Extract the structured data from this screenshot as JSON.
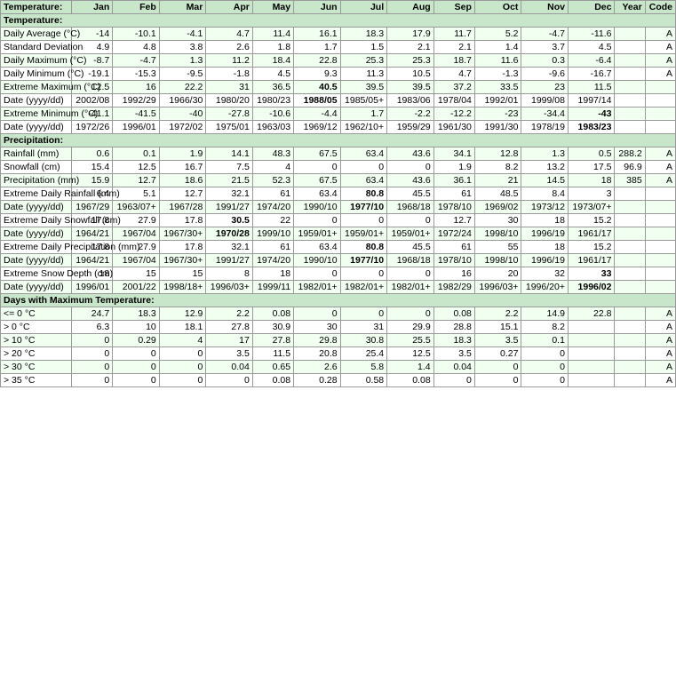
{
  "headers": {
    "row_header": "Temperature:",
    "months": [
      "Jan",
      "Feb",
      "Mar",
      "Apr",
      "May",
      "Jun",
      "Jul",
      "Aug",
      "Sep",
      "Oct",
      "Nov",
      "Dec",
      "Year",
      "Code"
    ]
  },
  "sections": [
    {
      "name": "Temperature:",
      "is_section": true
    },
    {
      "name": "Daily Average (°C)",
      "values": [
        "-14",
        "-10.1",
        "-4.1",
        "4.7",
        "11.4",
        "16.1",
        "18.3",
        "17.9",
        "11.7",
        "5.2",
        "-4.7",
        "-11.6",
        "",
        "A"
      ],
      "bg": "light"
    },
    {
      "name": "Standard Deviation",
      "values": [
        "4.9",
        "4.8",
        "3.8",
        "2.6",
        "1.8",
        "1.7",
        "1.5",
        "2.1",
        "2.1",
        "1.4",
        "3.7",
        "4.5",
        "",
        "A"
      ],
      "bg": "white"
    },
    {
      "name": "Daily Maximum (°C)",
      "values": [
        "-8.7",
        "-4.7",
        "1.3",
        "11.2",
        "18.4",
        "22.8",
        "25.3",
        "25.3",
        "18.7",
        "11.6",
        "0.3",
        "-6.4",
        "",
        "A"
      ],
      "bg": "light"
    },
    {
      "name": "Daily Minimum (°C)",
      "values": [
        "-19.1",
        "-15.3",
        "-9.5",
        "-1.8",
        "4.5",
        "9.3",
        "11.3",
        "10.5",
        "4.7",
        "-1.3",
        "-9.6",
        "-16.7",
        "",
        "A"
      ],
      "bg": "white"
    },
    {
      "name": "Extreme Maximum (°C)",
      "values": [
        "12.5",
        "16",
        "22.2",
        "31",
        "36.5",
        "40.5",
        "39.5",
        "39.5",
        "37.2",
        "33.5",
        "23",
        "11.5",
        "",
        ""
      ],
      "bold_cols": [
        5
      ],
      "bg": "light"
    },
    {
      "name": "Date (yyyy/dd)",
      "values": [
        "2002/08",
        "1992/29",
        "1966/30",
        "1980/20",
        "1980/23",
        "1988/05",
        "1985/05+",
        "1983/06",
        "1978/04",
        "1992/01",
        "1999/08",
        "1997/14",
        "",
        ""
      ],
      "bold_cols": [
        5
      ],
      "bg": "white"
    },
    {
      "name": "Extreme Minimum (°C)",
      "values": [
        "-41.1",
        "-41.5",
        "-40",
        "-27.8",
        "-10.6",
        "-4.4",
        "1.7",
        "-2.2",
        "-12.2",
        "-23",
        "-34.4",
        "-43",
        "",
        ""
      ],
      "bold_cols": [
        11
      ],
      "bg": "light"
    },
    {
      "name": "Date (yyyy/dd)",
      "values": [
        "1972/26",
        "1996/01",
        "1972/02",
        "1975/01",
        "1963/03",
        "1969/12",
        "1962/10+",
        "1959/29",
        "1961/30",
        "1991/30",
        "1978/19",
        "1983/23",
        "",
        ""
      ],
      "bold_cols": [
        11
      ],
      "bg": "white"
    },
    {
      "name": "Precipitation:",
      "is_section": true
    },
    {
      "name": "Rainfall (mm)",
      "values": [
        "0.6",
        "0.1",
        "1.9",
        "14.1",
        "48.3",
        "67.5",
        "63.4",
        "43.6",
        "34.1",
        "12.8",
        "1.3",
        "0.5",
        "288.2",
        "A"
      ],
      "bg": "light"
    },
    {
      "name": "Snowfall (cm)",
      "values": [
        "15.4",
        "12.5",
        "16.7",
        "7.5",
        "4",
        "0",
        "0",
        "0",
        "1.9",
        "8.2",
        "13.2",
        "17.5",
        "96.9",
        "A"
      ],
      "bg": "white"
    },
    {
      "name": "Precipitation (mm)",
      "values": [
        "15.9",
        "12.7",
        "18.6",
        "21.5",
        "52.3",
        "67.5",
        "63.4",
        "43.6",
        "36.1",
        "21",
        "14.5",
        "18",
        "385",
        "A"
      ],
      "bg": "light"
    },
    {
      "name": "Extreme Daily Rainfall (mm)",
      "values": [
        "6.4",
        "5.1",
        "12.7",
        "32.1",
        "61",
        "63.4",
        "80.8",
        "45.5",
        "61",
        "48.5",
        "8.4",
        "3",
        "",
        ""
      ],
      "bold_cols": [
        6
      ],
      "bg": "white"
    },
    {
      "name": "Date (yyyy/dd)",
      "values": [
        "1967/29",
        "1963/07+",
        "1967/28",
        "1991/27",
        "1974/20",
        "1990/10",
        "1977/10",
        "1968/18",
        "1978/10",
        "1969/02",
        "1973/12",
        "1973/07+",
        "",
        ""
      ],
      "bold_cols": [
        6
      ],
      "bg": "light"
    },
    {
      "name": "Extreme Daily Snowfall (cm)",
      "values": [
        "17.8",
        "27.9",
        "17.8",
        "30.5",
        "22",
        "0",
        "0",
        "0",
        "12.7",
        "30",
        "18",
        "15.2",
        "",
        ""
      ],
      "bold_cols": [
        3
      ],
      "bg": "white"
    },
    {
      "name": "Date (yyyy/dd)",
      "values": [
        "1964/21",
        "1967/04",
        "1967/30+",
        "1970/28",
        "1999/10",
        "1959/01+",
        "1959/01+",
        "1959/01+",
        "1972/24",
        "1998/10",
        "1996/19",
        "1961/17",
        "",
        ""
      ],
      "bold_cols": [
        3
      ],
      "bg": "light"
    },
    {
      "name": "Extreme Daily Precipitation (mm)",
      "values": [
        "17.8",
        "27.9",
        "17.8",
        "32.1",
        "61",
        "63.4",
        "80.8",
        "45.5",
        "61",
        "55",
        "18",
        "15.2",
        "",
        ""
      ],
      "bold_cols": [
        6
      ],
      "bg": "white"
    },
    {
      "name": "Date (yyyy/dd)",
      "values": [
        "1964/21",
        "1967/04",
        "1967/30+",
        "1991/27",
        "1974/20",
        "1990/10",
        "1977/10",
        "1968/18",
        "1978/10",
        "1998/10",
        "1996/19",
        "1961/17",
        "",
        ""
      ],
      "bold_cols": [
        6
      ],
      "bg": "light"
    },
    {
      "name": "Extreme Snow Depth (cm)",
      "values": [
        "18",
        "15",
        "15",
        "8",
        "18",
        "0",
        "0",
        "0",
        "16",
        "20",
        "32",
        "33",
        "",
        ""
      ],
      "bold_cols": [
        11
      ],
      "bg": "white"
    },
    {
      "name": "Date (yyyy/dd)",
      "values": [
        "1996/01",
        "2001/22",
        "1998/18+",
        "1996/03+",
        "1999/11",
        "1982/01+",
        "1982/01+",
        "1982/01+",
        "1982/29",
        "1996/03+",
        "1996/20+",
        "1996/02",
        "",
        ""
      ],
      "bold_cols": [
        11
      ],
      "bg": "light"
    },
    {
      "name": "Days with Maximum Temperature:",
      "is_section": true
    },
    {
      "name": "<= 0 °C",
      "values": [
        "24.7",
        "18.3",
        "12.9",
        "2.2",
        "0.08",
        "0",
        "0",
        "0",
        "0.08",
        "2.2",
        "14.9",
        "22.8",
        "",
        "A"
      ],
      "bg": "light"
    },
    {
      "name": "> 0 °C",
      "values": [
        "6.3",
        "10",
        "18.1",
        "27.8",
        "30.9",
        "30",
        "31",
        "29.9",
        "28.8",
        "15.1",
        "8.2",
        "",
        "",
        "A"
      ],
      "bg": "white"
    },
    {
      "name": "> 10 °C",
      "values": [
        "0",
        "0.29",
        "4",
        "17",
        "27.8",
        "29.8",
        "30.8",
        "25.5",
        "18.3",
        "3.5",
        "0.1",
        "",
        "",
        "A"
      ],
      "bg": "light"
    },
    {
      "name": "> 20 °C",
      "values": [
        "0",
        "0",
        "0",
        "3.5",
        "11.5",
        "20.8",
        "25.4",
        "12.5",
        "3.5",
        "0.27",
        "0",
        "",
        "",
        "A"
      ],
      "bg": "white"
    },
    {
      "name": "> 30 °C",
      "values": [
        "0",
        "0",
        "0",
        "0.04",
        "0.65",
        "2.6",
        "5.8",
        "1.4",
        "0.04",
        "0",
        "0",
        "",
        "",
        "A"
      ],
      "bg": "light"
    },
    {
      "name": "> 35 °C",
      "values": [
        "0",
        "0",
        "0",
        "0",
        "0.08",
        "0.28",
        "0.58",
        "0.08",
        "0",
        "0",
        "0",
        "",
        "",
        "A"
      ],
      "bg": "white"
    }
  ]
}
